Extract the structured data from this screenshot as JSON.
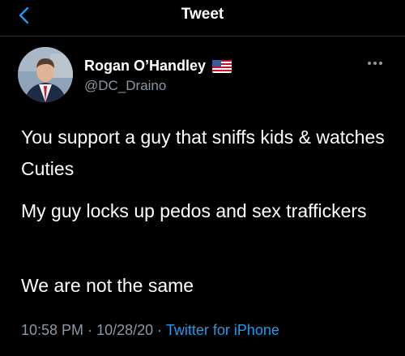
{
  "header": {
    "title": "Tweet",
    "back_icon": "chevron-left-icon",
    "accent_color": "#1d9bf0"
  },
  "author": {
    "name": "Rogan O’Handley",
    "handle": "@DC_Draino",
    "badge_icon": "us-flag-icon"
  },
  "tweet": {
    "paragraphs": [
      "You support a guy that sniffs kids & watches Cuties",
      "My guy locks up pedos and sex traffickers",
      "We are not the same"
    ],
    "time": "10:58 PM",
    "separator": "·",
    "date": "10/28/20",
    "source": "Twitter for iPhone"
  },
  "menu": {
    "more_icon": "more-horizontal-icon"
  }
}
